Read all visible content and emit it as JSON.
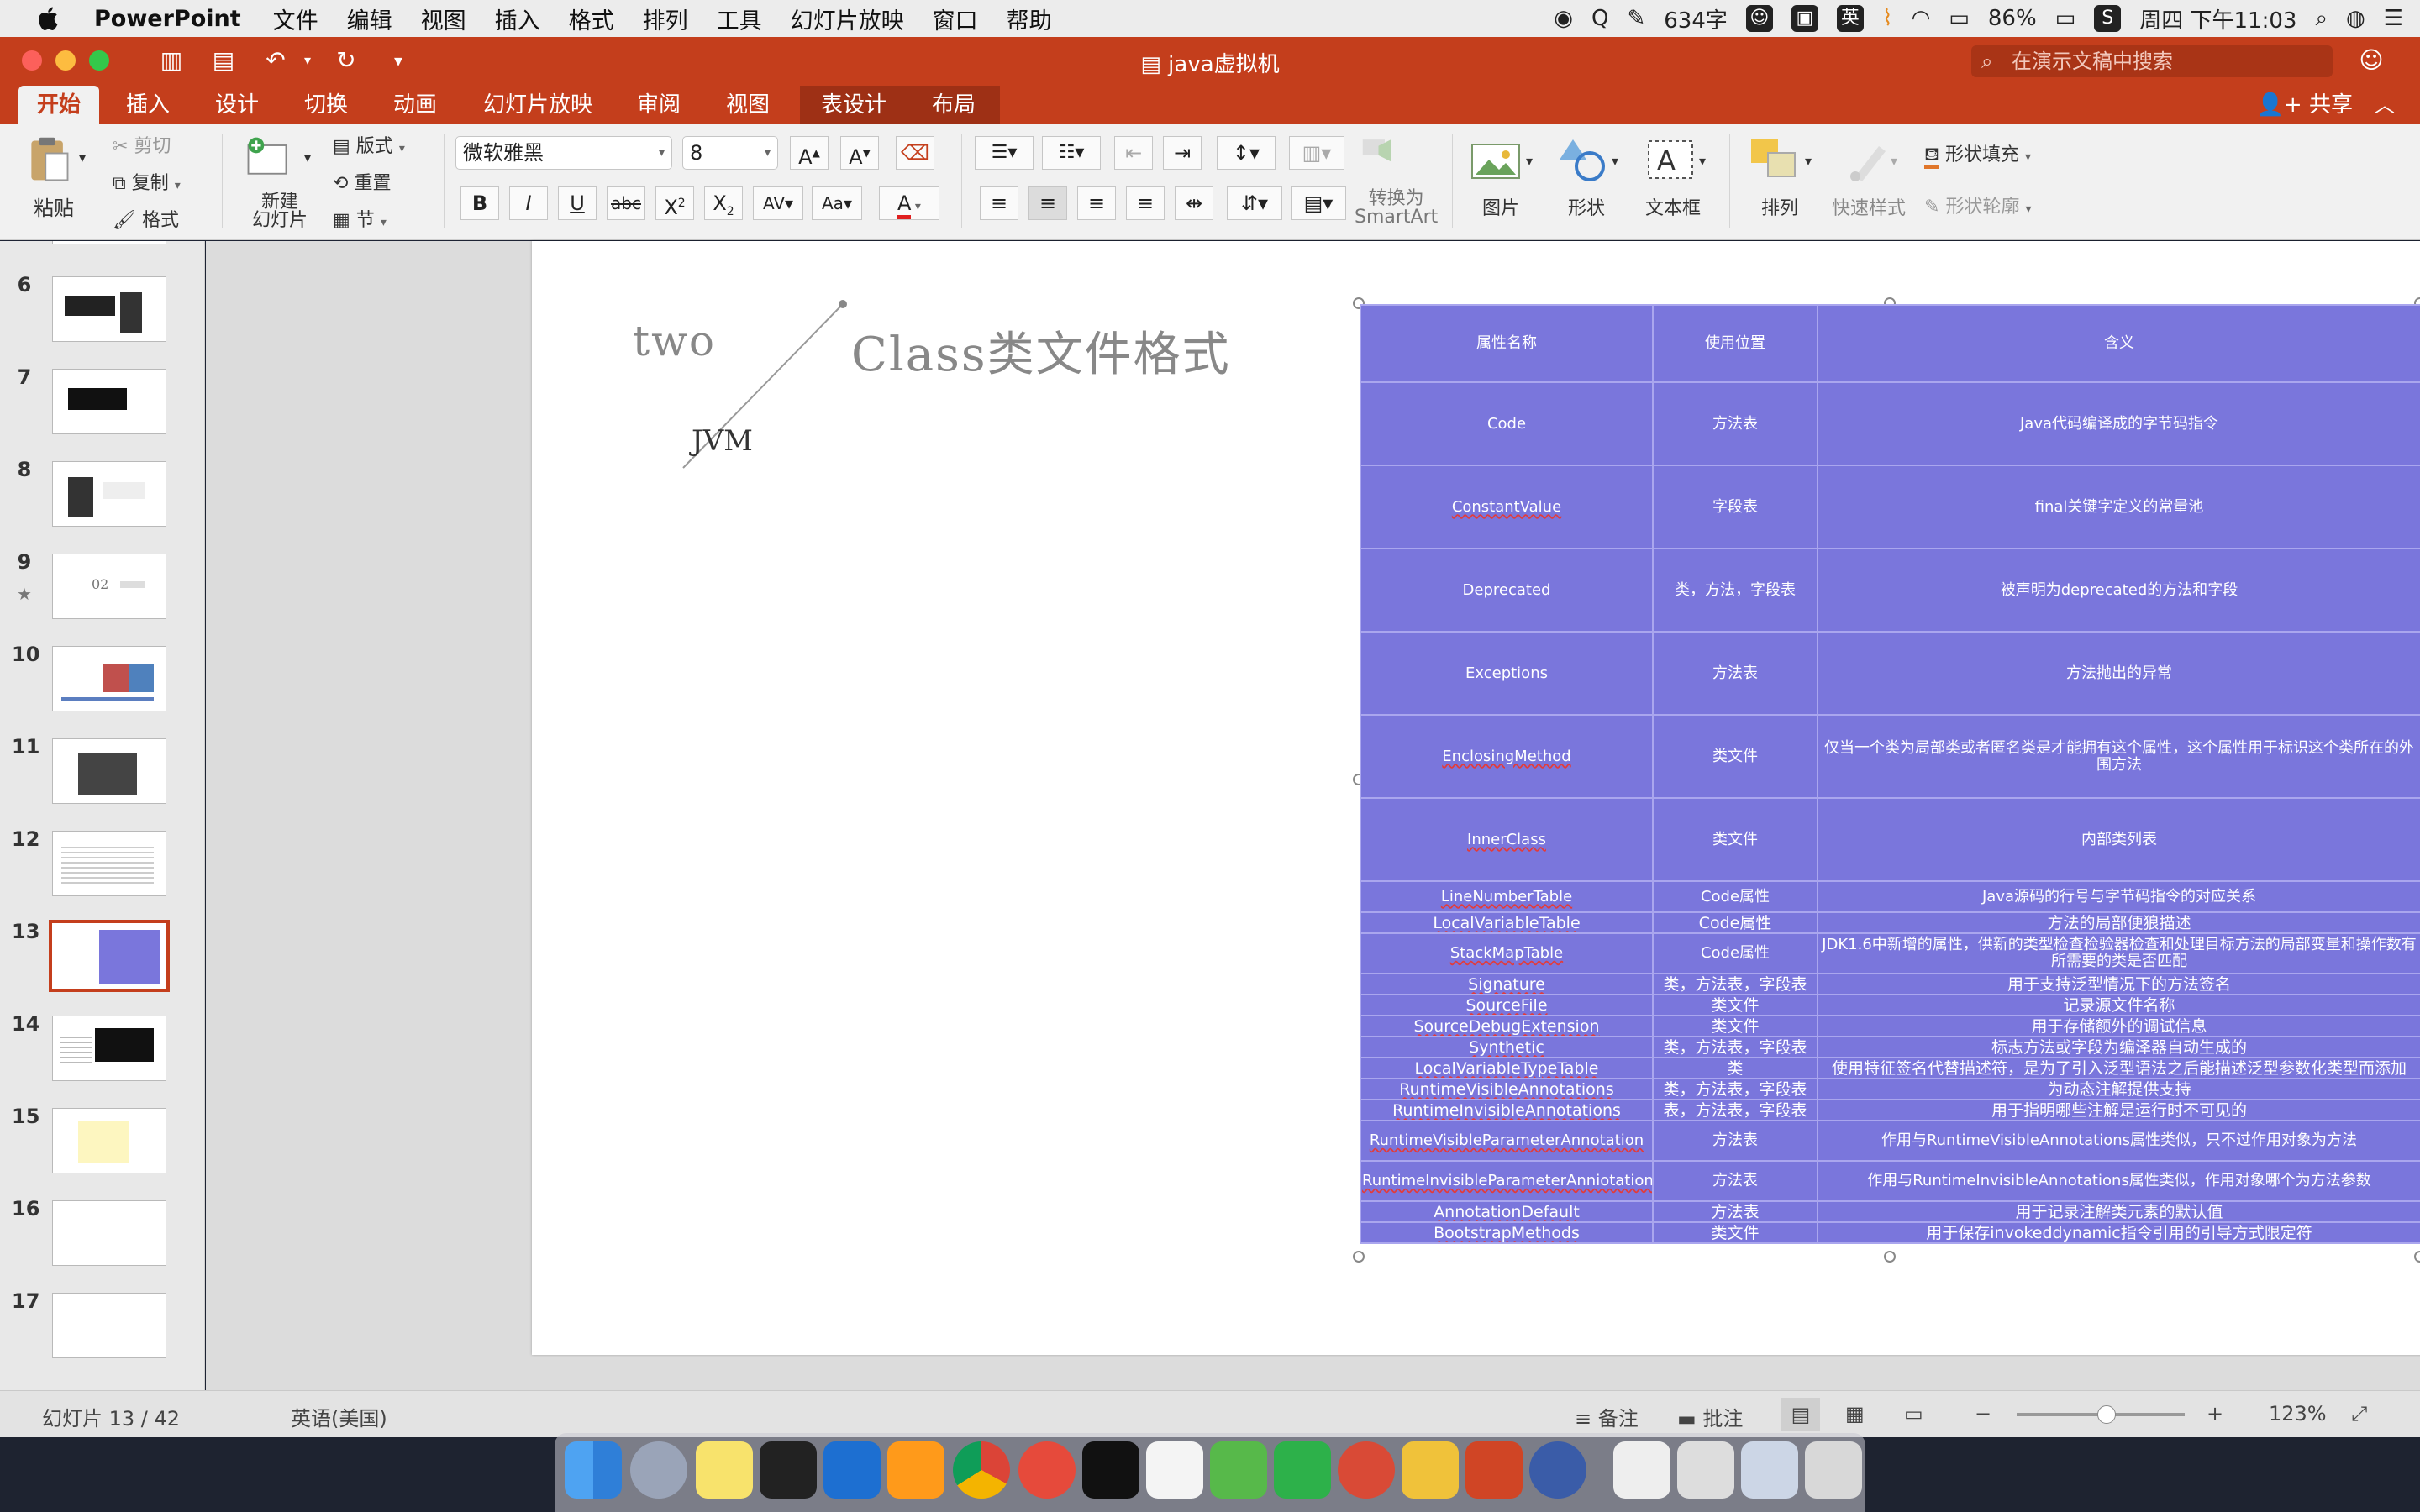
{
  "menubar": {
    "app_name": "PowerPoint",
    "items": [
      "文件",
      "编辑",
      "视图",
      "插入",
      "格式",
      "排列",
      "工具",
      "幻灯片放映",
      "窗口",
      "帮助"
    ],
    "word_count": "634字",
    "input_method": "英",
    "battery": "86%",
    "clock": "周四 下午11:03"
  },
  "window": {
    "title": "java虚拟机",
    "search_placeholder": "在演示文稿中搜索"
  },
  "ribbon_tabs": [
    "开始",
    "插入",
    "设计",
    "切换",
    "动画",
    "幻灯片放映",
    "审阅",
    "视图",
    "表设计",
    "布局"
  ],
  "share_label": "共享",
  "ribbon": {
    "paste": "粘贴",
    "cut": "剪切",
    "copy": "复制",
    "format": "格式",
    "new_slide": "新建\n幻灯片",
    "layout": "版式",
    "reset": "重置",
    "section": "节",
    "font_name": "微软雅黑",
    "font_size": "8",
    "convert_smartart": "转换为\nSmartArt",
    "picture": "图片",
    "shape": "形状",
    "textbox": "文本框",
    "arrange": "排列",
    "quick_styles": "快速样式",
    "shape_fill": "形状填充",
    "shape_outline": "形状轮廓"
  },
  "thumbnails": [
    "6",
    "7",
    "8",
    "9",
    "10",
    "11",
    "12",
    "13",
    "14",
    "15",
    "16",
    "17"
  ],
  "slide": {
    "two": "two",
    "jvm": "JVM",
    "title": "Class类文件格式"
  },
  "table": {
    "headers": [
      "属性名称",
      "使用位置",
      "含义"
    ],
    "rows": [
      [
        "Code",
        "方法表",
        "Java代码编译成的字节码指令"
      ],
      [
        "ConstantValue",
        "字段表",
        "final关键字定义的常量池"
      ],
      [
        "Deprecated",
        "类，方法，字段表",
        "被声明为deprecated的方法和字段"
      ],
      [
        "Exceptions",
        "方法表",
        "方法抛出的异常"
      ],
      [
        "EnclosingMethod",
        "类文件",
        "仅当一个类为局部类或者匿名类是才能拥有这个属性，这个属性用于标识这个类所在的外围方法"
      ],
      [
        "InnerClass",
        "类文件",
        "内部类列表"
      ],
      [
        "LineNumberTable",
        "Code属性",
        "Java源码的行号与字节码指令的对应关系"
      ],
      [
        "LocalVariableTable",
        "Code属性",
        "方法的局部便狼描述"
      ],
      [
        "StackMapTable",
        "Code属性",
        "JDK1.6中新增的属性，供新的类型检查检验器检查和处理目标方法的局部变量和操作数有所需要的类是否匹配"
      ],
      [
        "Signature",
        "类，方法表，字段表",
        "用于支持泛型情况下的方法签名"
      ],
      [
        "SourceFile",
        "类文件",
        "记录源文件名称"
      ],
      [
        "SourceDebugExtension",
        "类文件",
        "用于存储额外的调试信息"
      ],
      [
        "Synthetic",
        "类，方法表，字段表",
        "标志方法或字段为编泽器自动生成的"
      ],
      [
        "LocalVariableTypeTable",
        "类",
        "使用特征签名代替描述符，是为了引入泛型语法之后能描述泛型参数化类型而添加"
      ],
      [
        "RuntimeVisibleAnnotations",
        "类，方法表，字段表",
        "为动态注解提供支持"
      ],
      [
        "RuntimeInvisibleAnnotations",
        "表，方法表，字段表",
        "用于指明哪些注解是运行时不可见的"
      ],
      [
        "RuntimeVisibleParameterAnnotation",
        "方法表",
        "作用与RuntimeVisibleAnnotations属性类似，只不过作用对象为方法"
      ],
      [
        "RuntimeInvisibleParameterAnniotation",
        "方法表",
        "作用与RuntimeInvisibleAnnotations属性类似，作用对象哪个为方法参数"
      ],
      [
        "AnnotationDefault",
        "方法表",
        "用于记录注解类元素的默认值"
      ],
      [
        "BootstrapMethods",
        "类文件",
        "用于保存invokeddynamic指令引用的引导方式限定符"
      ]
    ]
  },
  "statusbar": {
    "slide_position": "幻灯片 13 / 42",
    "language": "英语(美国)",
    "notes": "备注",
    "comments": "批注",
    "zoom": "123%"
  }
}
